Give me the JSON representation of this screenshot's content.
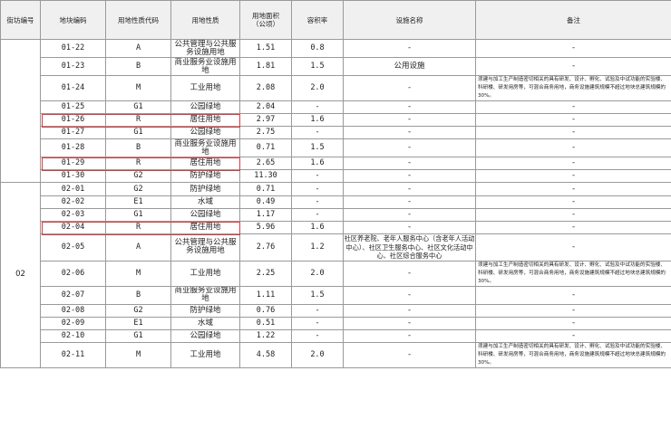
{
  "headers": {
    "district": "街坊编号",
    "plot_code": "地块编码",
    "land_use_code": "用地性质代码",
    "land_use": "用地性质",
    "area": "用地面积（公顷）",
    "far": "容积率",
    "facility": "设施名称",
    "note": "备注"
  },
  "district_02_label": "02",
  "note_text": "须建与加工生产制造密切相关的具有研发、设计、孵化、试验及中试功能的实验楼、科研楼、研发用房等，可混合商务用地，商务设施建筑规模不超过地块总建筑规模的 30%。",
  "rows": [
    {
      "plot": "01-22",
      "code": "A",
      "use": "公共管理与公共服务设施用地",
      "area": "1.51",
      "far": "0.8",
      "facility": "-",
      "note": "-"
    },
    {
      "plot": "01-23",
      "code": "B",
      "use": "商业服务业设施用地",
      "area": "1.81",
      "far": "1.5",
      "facility": "公用设施",
      "note": "-"
    },
    {
      "plot": "01-24",
      "code": "M",
      "use": "工业用地",
      "area": "2.08",
      "far": "2.0",
      "facility": "-",
      "note": "须建与加工生产制造密切相关的具有研发、设计、孵化、试验及中试功能的实验楼、科研楼、研发用房等，可混合商务用地，商务设施建筑规模不超过地块总建筑规模的 30%。"
    },
    {
      "plot": "01-25",
      "code": "G1",
      "use": "公园绿地",
      "area": "2.04",
      "far": "-",
      "facility": "-",
      "note": "-"
    },
    {
      "plot": "01-26",
      "code": "R",
      "use": "居住用地",
      "area": "2.97",
      "far": "1.6",
      "facility": "-",
      "note": "-"
    },
    {
      "plot": "01-27",
      "code": "G1",
      "use": "公园绿地",
      "area": "2.75",
      "far": "-",
      "facility": "-",
      "note": "-"
    },
    {
      "plot": "01-28",
      "code": "B",
      "use": "商业服务业设施用地",
      "area": "0.71",
      "far": "1.5",
      "facility": "-",
      "note": "-"
    },
    {
      "plot": "01-29",
      "code": "R",
      "use": "居住用地",
      "area": "2.65",
      "far": "1.6",
      "facility": "-",
      "note": "-"
    },
    {
      "plot": "01-30",
      "code": "G2",
      "use": "防护绿地",
      "area": "11.30",
      "far": "-",
      "facility": "-",
      "note": "-"
    },
    {
      "plot": "02-01",
      "code": "G2",
      "use": "防护绿地",
      "area": "0.71",
      "far": "-",
      "facility": "-",
      "note": "-"
    },
    {
      "plot": "02-02",
      "code": "E1",
      "use": "水域",
      "area": "0.49",
      "far": "-",
      "facility": "-",
      "note": "-"
    },
    {
      "plot": "02-03",
      "code": "G1",
      "use": "公园绿地",
      "area": "1.17",
      "far": "-",
      "facility": "-",
      "note": "-"
    },
    {
      "plot": "02-04",
      "code": "R",
      "use": "居住用地",
      "area": "5.96",
      "far": "1.6",
      "facility": "-",
      "note": "-"
    },
    {
      "plot": "02-05",
      "code": "A",
      "use": "公共管理与公共服务设施用地",
      "area": "2.76",
      "far": "1.2",
      "facility": "社区养老院、老年人服务中心（含老年人活动中心）、社区卫生服务中心、社区文化活动中心、社区综合服务中心",
      "note": "-"
    },
    {
      "plot": "02-06",
      "code": "M",
      "use": "工业用地",
      "area": "2.25",
      "far": "2.0",
      "facility": "-",
      "note": "须建与加工生产制造密切相关的具有研发、设计、孵化、试验及中试功能的实验楼、科研楼、研发用房等，可混合商务用地，商务设施建筑规模不超过地块总建筑规模的 30%。"
    },
    {
      "plot": "02-07",
      "code": "B",
      "use": "商业服务业设施用地",
      "area": "1.11",
      "far": "1.5",
      "facility": "-",
      "note": "-"
    },
    {
      "plot": "02-08",
      "code": "G2",
      "use": "防护绿地",
      "area": "0.76",
      "far": "-",
      "facility": "-",
      "note": "-"
    },
    {
      "plot": "02-09",
      "code": "E1",
      "use": "水域",
      "area": "0.51",
      "far": "-",
      "facility": "-",
      "note": "-"
    },
    {
      "plot": "02-10",
      "code": "G1",
      "use": "公园绿地",
      "area": "1.22",
      "far": "-",
      "facility": "-",
      "note": "-"
    },
    {
      "plot": "02-11",
      "code": "M",
      "use": "工业用地",
      "area": "4.58",
      "far": "2.0",
      "facility": "-",
      "note": "须建与加工生产制造密切相关的具有研发、设计、孵化、试验及中试功能的实验楼、科研楼、研发用房等，可混合商务用地，商务设施建筑规模不超过地块总建筑规模的 30%。"
    }
  ],
  "highlight_color": "#e0383c"
}
